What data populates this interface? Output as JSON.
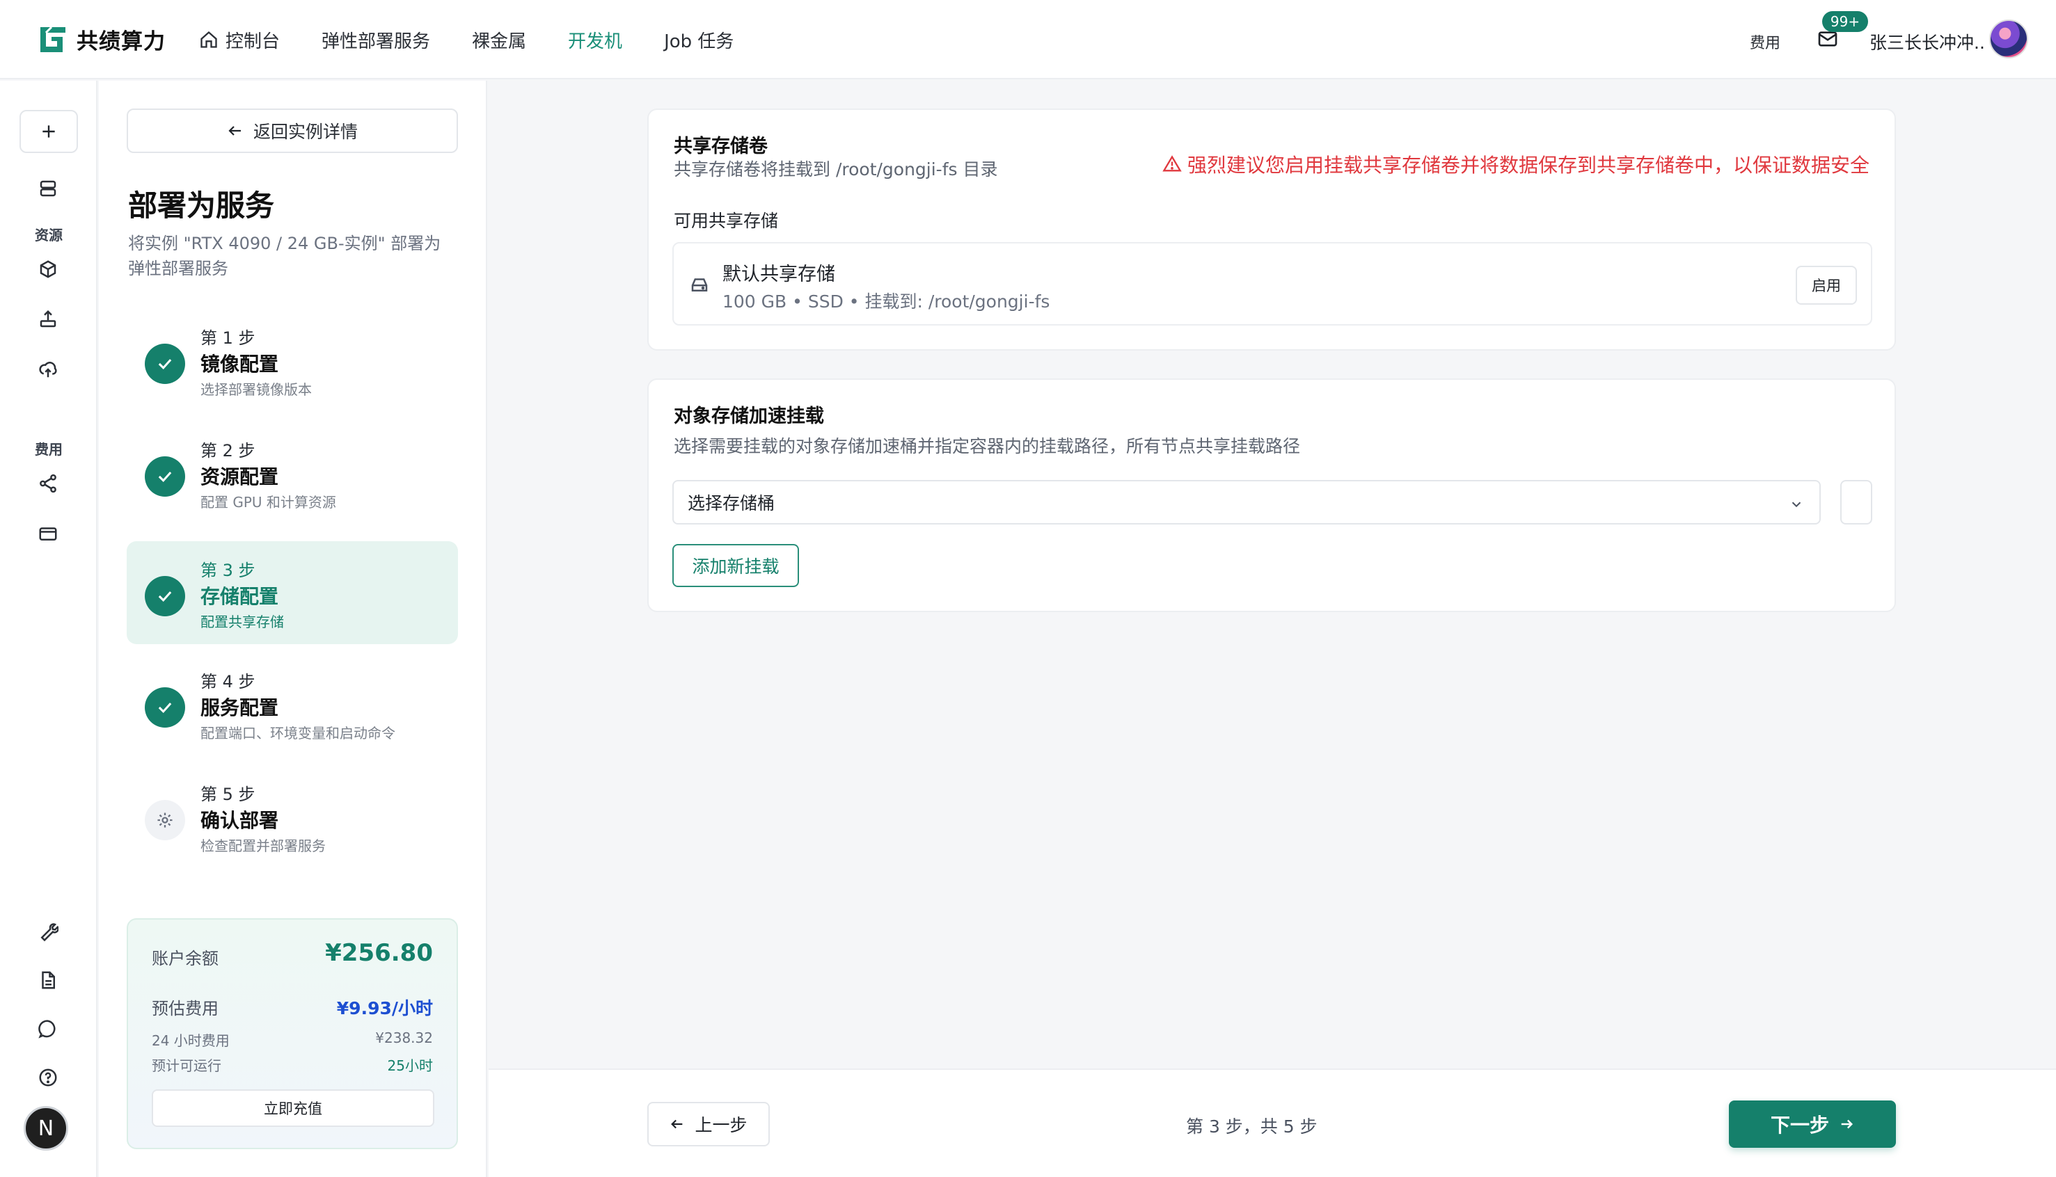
{
  "brand": {
    "name": "共绩算力",
    "accent": "#15806b",
    "warning": "#e0383e"
  },
  "nav": [
    {
      "label": "控制台",
      "icon": "home-icon"
    },
    {
      "label": "弹性部署服务"
    },
    {
      "label": "裸金属"
    },
    {
      "label": "开发机",
      "active": true
    },
    {
      "label": "Job 任务"
    }
  ],
  "header": {
    "fee_label": "费用",
    "mail_badge": "99+",
    "user_name": "张三长长冲冲.."
  },
  "rail": {
    "section_resources": "资源",
    "section_fees": "费用",
    "avatar_letter": "N"
  },
  "steps_panel": {
    "back_label": "返回实例详情",
    "title": "部署为服务",
    "description": "将实例 \"RTX 4090 / 24 GB-实例\" 部署为弹性部署服务",
    "steps": [
      {
        "num": "第 1 步",
        "name": "镜像配置",
        "sub": "选择部署镜像版本"
      },
      {
        "num": "第 2 步",
        "name": "资源配置",
        "sub": "配置 GPU 和计算资源"
      },
      {
        "num": "第 3 步",
        "name": "存储配置",
        "sub": "配置共享存储"
      },
      {
        "num": "第 4 步",
        "name": "服务配置",
        "sub": "配置端口、环境变量和启动命令"
      },
      {
        "num": "第 5 步",
        "name": "确认部署",
        "sub": "检查配置并部署服务"
      }
    ]
  },
  "balance": {
    "balance_label": "账户余额",
    "balance_value": "¥256.80",
    "estimate_label": "预估费用",
    "estimate_value": "¥9.93/小时",
    "daily_label": "24 小时费用",
    "daily_value": "¥238.32",
    "runtime_label": "预计可运行",
    "runtime_value": "25小时",
    "recharge_label": "立即充值"
  },
  "shared_storage": {
    "title": "共享存储卷",
    "subtitle": "共享存储卷将挂载到 /root/gongji-fs 目录",
    "warning": "强烈建议您启用挂载共享存储卷并将数据保存到共享存储卷中，以保证数据安全",
    "available_label": "可用共享存储",
    "item_name": "默认共享存储",
    "item_meta": "100 GB • SSD • 挂载到: /root/gongji-fs",
    "enable_label": "启用"
  },
  "object_storage": {
    "title": "对象存储加速挂载",
    "subtitle": "选择需要挂载的对象存储加速桶并指定容器内的挂载路径，所有节点共享挂载路径",
    "select_placeholder": "选择存储桶",
    "add_label": "添加新挂载"
  },
  "footer": {
    "prev_label": "上一步",
    "indicator": "第 3 步，共 5 步",
    "next_label": "下一步"
  }
}
